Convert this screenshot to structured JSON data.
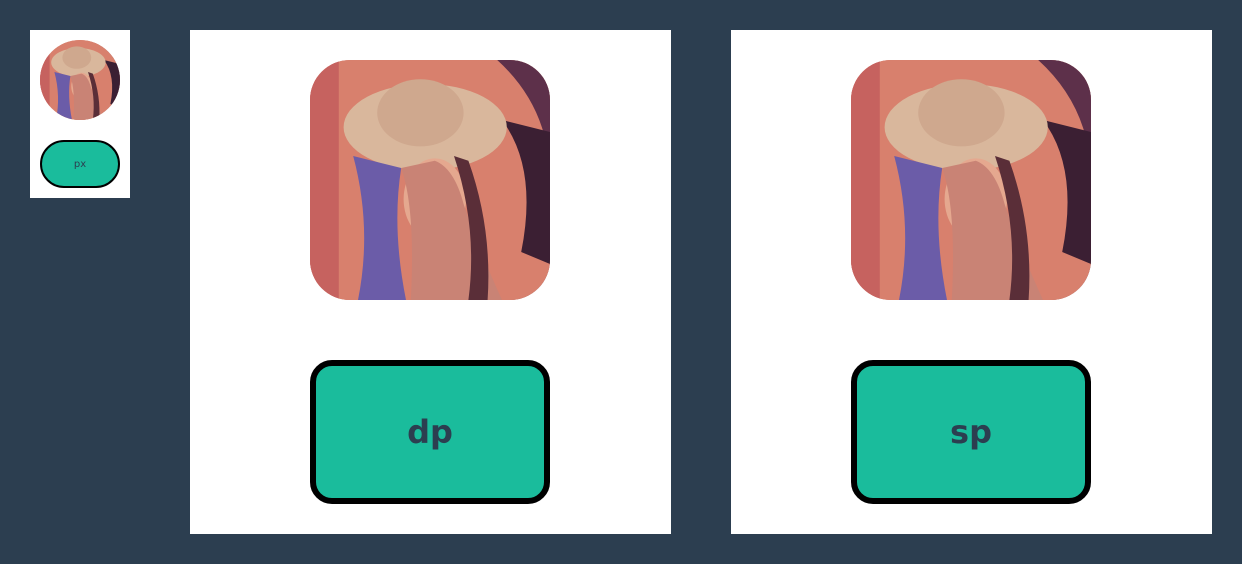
{
  "colors": {
    "background": "#2c3e50",
    "panel": "#ffffff",
    "button_fill": "#1abc9c",
    "button_border": "#000000",
    "button_text": "#2c3e50"
  },
  "panels": [
    {
      "id": "px",
      "image": "portrait-photo",
      "button_label": "px"
    },
    {
      "id": "dp",
      "image": "portrait-photo",
      "button_label": "dp"
    },
    {
      "id": "sp",
      "image": "portrait-photo",
      "button_label": "sp"
    }
  ]
}
